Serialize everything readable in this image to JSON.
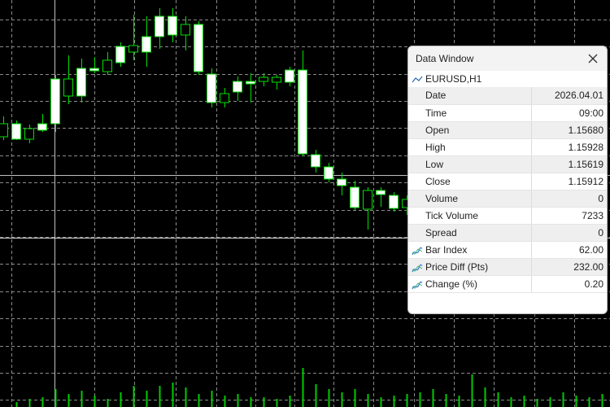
{
  "data_window": {
    "title": "Data Window",
    "close_icon": "close-icon",
    "symbol_icon": "line-chart-icon",
    "symbol": "EURUSD,H1",
    "rows": [
      {
        "label": "Date",
        "value": "2026.04.01",
        "indicator": false
      },
      {
        "label": "Time",
        "value": "09:00",
        "indicator": false
      },
      {
        "label": "Open",
        "value": "1.15680",
        "indicator": false
      },
      {
        "label": "High",
        "value": "1.15928",
        "indicator": false
      },
      {
        "label": "Low",
        "value": "1.15619",
        "indicator": false
      },
      {
        "label": "Close",
        "value": "1.15912",
        "indicator": false
      },
      {
        "label": "Volume",
        "value": "0",
        "indicator": false
      },
      {
        "label": "Tick Volume",
        "value": "7233",
        "indicator": false
      },
      {
        "label": "Spread",
        "value": "0",
        "indicator": false
      },
      {
        "label": "Bar Index",
        "value": "62.00",
        "indicator": true
      },
      {
        "label": "Price Diff (Pts)",
        "value": "232.00",
        "indicator": true
      },
      {
        "label": "Change (%)",
        "value": "0.20",
        "indicator": true
      }
    ]
  },
  "chart": {
    "background": "#000000",
    "grid_color": "#8a8a8a",
    "candle_color": "#00e000",
    "bull_fill": "#ffffff",
    "bear_fill": "#000000",
    "volume_color": "#00cc00",
    "crosshair_color": "#c0c0c0",
    "grid": true,
    "crosshair": true,
    "indicator_icon": "custom-indicator-icon"
  }
}
